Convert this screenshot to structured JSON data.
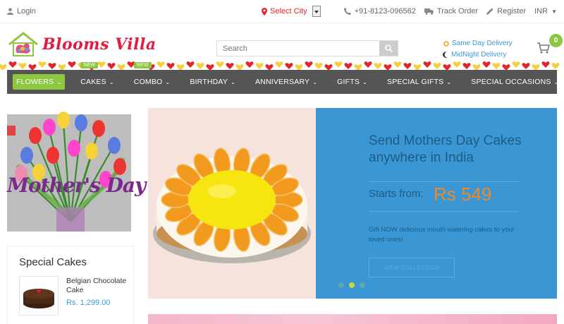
{
  "topbar": {
    "login_label": "Login",
    "city_label": "Select City",
    "phone": "+91-8123-096562",
    "track_label": "Track Order",
    "register_label": "Register",
    "currency": "INR"
  },
  "header": {
    "logo_text": "Blooms Villa",
    "search_placeholder": "Search",
    "same_day": "Same Day Delivery",
    "midnight": "MidNight Delivery",
    "cart_count": "0"
  },
  "nav": {
    "items": [
      {
        "label": "FLOWERS",
        "badge": ""
      },
      {
        "label": "CAKES",
        "badge": "NEW"
      },
      {
        "label": "COMBO",
        "badge": "NEW"
      },
      {
        "label": "BIRTHDAY",
        "badge": ""
      },
      {
        "label": "ANNIVERSARY",
        "badge": ""
      },
      {
        "label": "GIFTS",
        "badge": ""
      },
      {
        "label": "SPECIAL GIFTS",
        "badge": ""
      },
      {
        "label": "SPECIAL OCCASIONS",
        "badge": ""
      }
    ]
  },
  "promo": {
    "text": "Mother's Day"
  },
  "sidebar": {
    "title": "Special Cakes",
    "product_name": "Belgian Chocolate Cake",
    "product_price": "Rs. 1,299.00"
  },
  "slider": {
    "title": "Send Mothers Day Cakes anywhere in India",
    "starts_label": "Starts from:",
    "price": "Rs 549",
    "description": "Gift NOW delicious mouth watering cakes to your loved ones!",
    "button_label": "VIEW COLLECTION",
    "active_slide": 2,
    "slide_count": 3
  },
  "colors": {
    "accent_green": "#8dc63f",
    "nav_bg": "#555555",
    "brand_red": "#e31c3d",
    "link_blue": "#3a9ad9",
    "slide_blue": "#3b97d3",
    "price_orange": "#e88a2c"
  }
}
